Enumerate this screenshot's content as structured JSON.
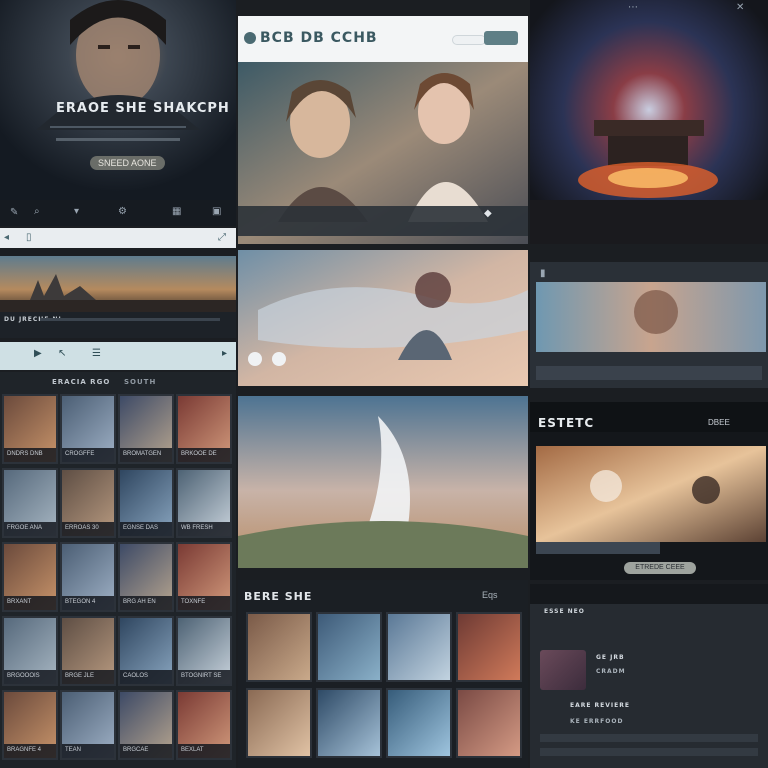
{
  "colors": {
    "background": "#1b1e22",
    "dark_panel": "#20252b",
    "light_panel": "#f1f3f5",
    "accent_teal": "#5e7f86"
  },
  "hero_card": {
    "title": "ERAOE SHE SHAKCPH",
    "button_label": "SNEED AONE",
    "icons": [
      "edit-icon",
      "search-icon",
      "filter-icon",
      "settings-icon",
      "grid-icon",
      "image-icon"
    ]
  },
  "white_header": {
    "logo": "BCB DB CCHB",
    "search_value": "",
    "button_label": ""
  },
  "banner_card": {
    "caption": "DU JRECHE NI"
  },
  "left_grid": {
    "header": "ERACIA RGO",
    "subheader": "SOUTH",
    "thumbs": [
      "DNDRS DNB",
      "CROGFFE",
      "BROMATGEN",
      "BRKOOE DE",
      "FRGOE ANA",
      "ERROAS 30",
      "EGNSE DAS",
      "WB FRESH",
      "BRXANT",
      "BTEGON 4",
      "BRG AH EN",
      "TOXNFE",
      "BRGOOOIS",
      "BRGE JLE",
      "CAOLOS",
      "BTOGNIRT SE",
      "BRAGNFE 4",
      "TEAN",
      "BRGCAE",
      "BEXLAT"
    ]
  },
  "right_promo": {
    "title": "ESTETC",
    "nav_right": "DBEE",
    "button_label": "ETREDE CEEE"
  },
  "bottom_grid": {
    "title": "BERE SHE",
    "menu_label": "Eqs"
  },
  "bottom_right": {
    "heading": "ESSE NEO",
    "lines": [
      "GE JRB",
      "CRADM",
      "EARE REVIERE",
      "KE ERRFOOD"
    ]
  }
}
